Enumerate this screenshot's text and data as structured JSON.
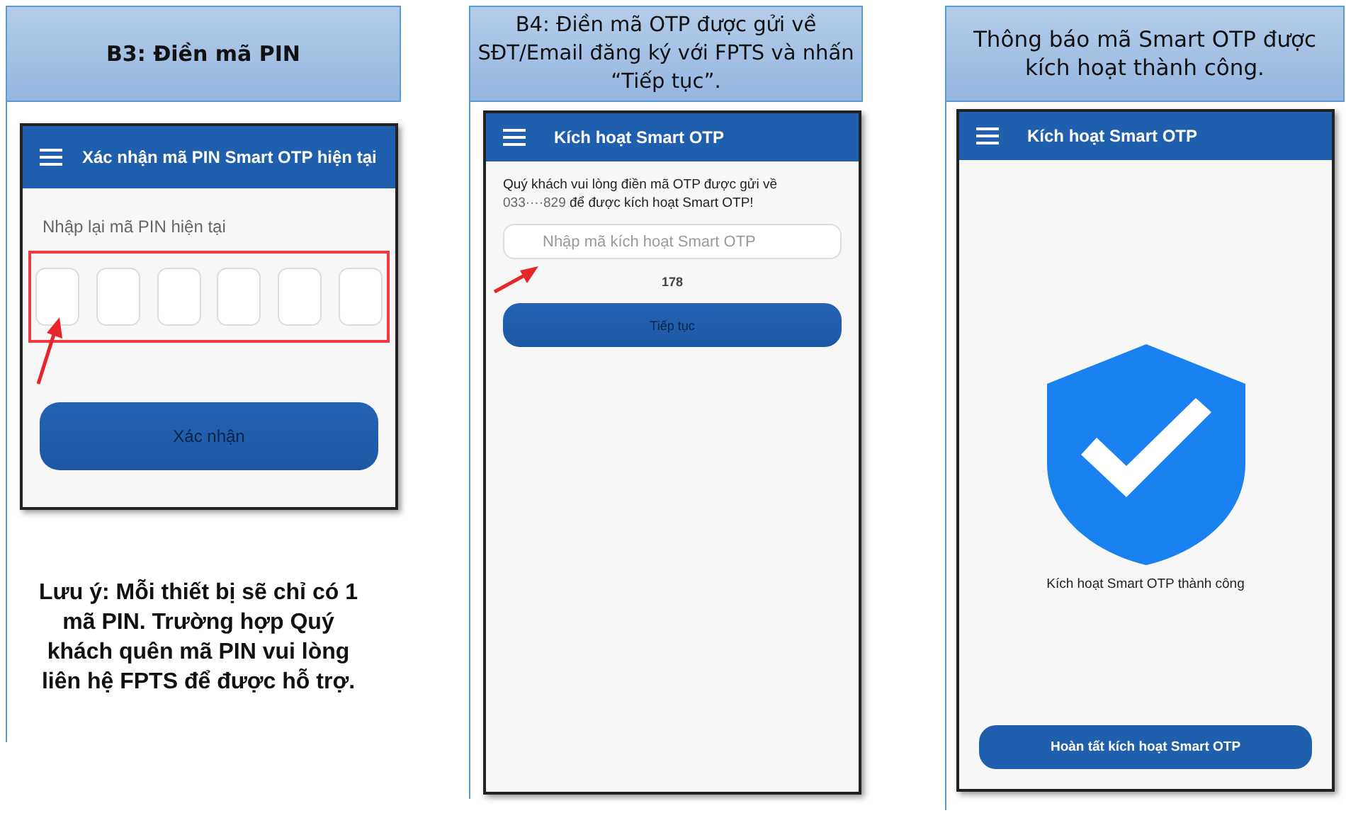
{
  "panels": [
    {
      "header": "B3: Điền mã PIN",
      "header_bold": true,
      "phone": {
        "kind": "pin",
        "title": "Xác nhận mã PIN Smart OTP hiện tại",
        "label": "Nhập lại mã PIN hiện tại",
        "pin_boxes": [
          {
            "filled": false
          },
          {
            "filled": false
          },
          {
            "filled": false
          },
          {
            "filled": false
          },
          {
            "filled": false
          },
          {
            "filled": false
          }
        ],
        "highlighted": true,
        "button": {
          "label": "Xác nhận",
          "disabled": true
        }
      },
      "note": "Lưu ý: Mỗi thiết bị sẽ chỉ có 1 mã PIN.  Trường hợp Quý khách quên mã PIN vui lòng liên hệ FPTS để được hỗ trợ."
    },
    {
      "header": "B4: Điền mã OTP được gửi về SĐT/Email đăng ký với FPTS và nhấn “Tiếp tục”.",
      "header_bold": false,
      "phone": {
        "kind": "otp",
        "title": "Kích hoạt Smart OTP",
        "message": "Quý khách vui lòng điền mã OTP được gửi về",
        "phone_number": "033····829",
        "message_end": "để được kích hoạt Smart OTP!",
        "placeholder": "Nhập mã kích hoạt Smart OTP",
        "countdown": "178",
        "button": {
          "label": "Tiếp tục",
          "disabled": true
        }
      }
    },
    {
      "header": "Thông báo mã Smart OTP được kích hoạt thành công.",
      "header_bold": false,
      "phone": {
        "kind": "success",
        "title": "Kích hoạt Smart OTP",
        "message": "Kích hoạt Smart OTP thành công",
        "button": {
          "label": "Hoàn tất kích hoạt Smart OTP",
          "disabled": false
        }
      }
    }
  ]
}
